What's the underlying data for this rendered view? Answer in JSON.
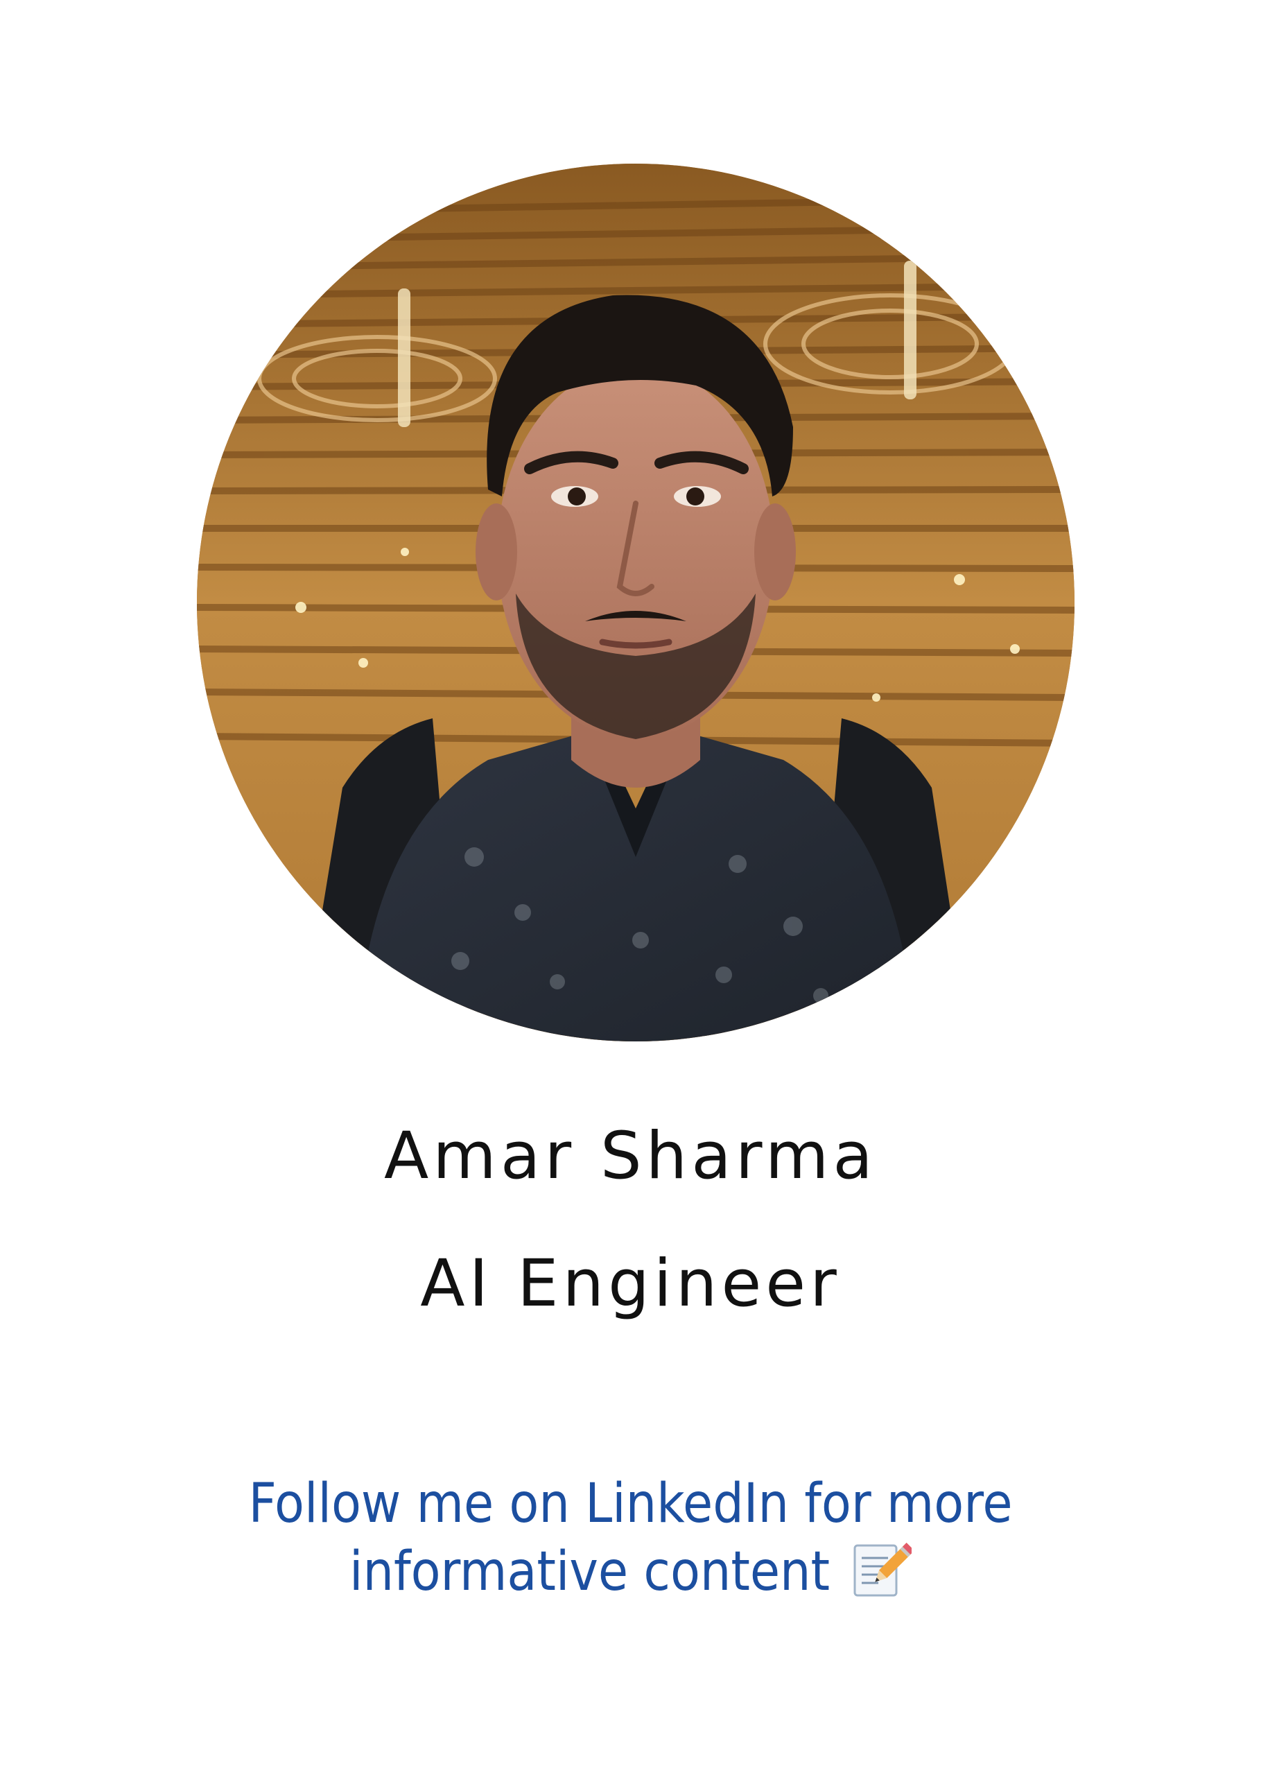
{
  "profile": {
    "name": "Amar Sharma",
    "role": "AI Engineer",
    "photo": "profile-photo"
  },
  "cta": {
    "line1": "Follow me on LinkedIn for more",
    "line2": "informative content",
    "icon": "memo-pencil-icon"
  },
  "colors": {
    "background": "#ffffff",
    "name_text": "#111111",
    "cta_text": "#1c4fa0"
  }
}
